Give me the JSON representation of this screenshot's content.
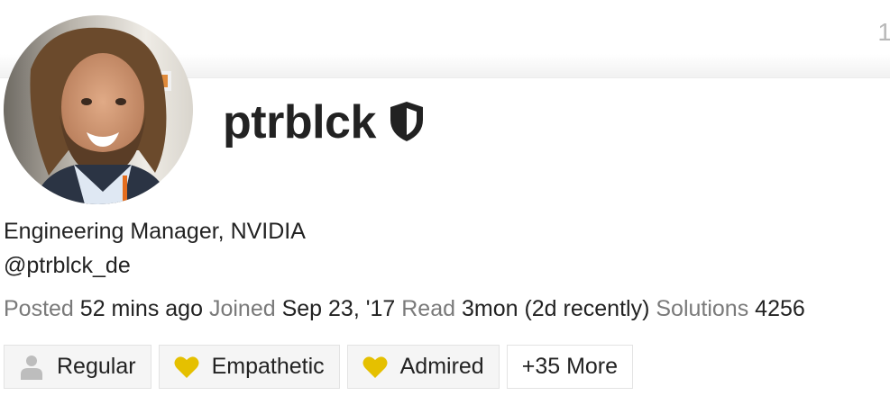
{
  "corner_number": "1",
  "user": {
    "username": "ptrblck",
    "title": "Engineering Manager, NVIDIA",
    "handle": "@ptrblck_de"
  },
  "stats": {
    "posted_label": "Posted",
    "posted_value": "52 mins ago",
    "joined_label": "Joined",
    "joined_value": "Sep 23, '17",
    "read_label": "Read",
    "read_value": "3mon (2d recently)",
    "solutions_label": "Solutions",
    "solutions_value": "4256"
  },
  "badges": [
    {
      "label": "Regular",
      "icon": "user-icon",
      "color": "#bdbdbd"
    },
    {
      "label": "Empathetic",
      "icon": "heart-icon",
      "color": "#e5c000"
    },
    {
      "label": "Admired",
      "icon": "heart-icon",
      "color": "#e5c000"
    }
  ],
  "more_badges": {
    "label": "+35 More"
  },
  "colors": {
    "text": "#222222",
    "muted": "#7a7a7a",
    "badge_gold": "#e5c000"
  }
}
